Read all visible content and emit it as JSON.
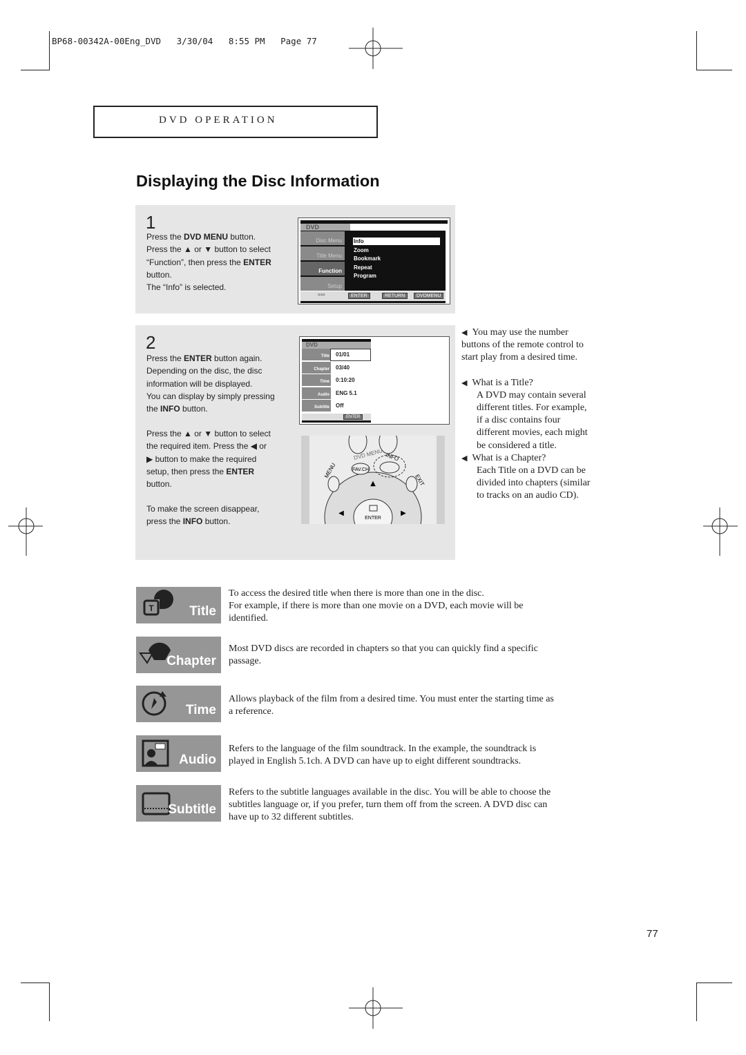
{
  "header": {
    "print_line": "BP68-00342A-00Eng_DVD   3/30/04   8:55 PM   Page 77"
  },
  "section": {
    "title": "DVD OPERATION"
  },
  "page_title": "Displaying the Disc Information",
  "step1": {
    "number": "1",
    "lines": [
      {
        "pre": "Press the ",
        "bold": "DVD MENU",
        "post": " button."
      },
      {
        "pre": "Press the ▲ or ▼ button to select",
        "bold": "",
        "post": ""
      },
      {
        "pre": "“Function”, then press the ",
        "bold": "ENTER",
        "post": ""
      },
      {
        "pre": "button.",
        "bold": "",
        "post": ""
      },
      {
        "pre": "The “Info” is selected.",
        "bold": "",
        "post": ""
      }
    ],
    "screen": {
      "header": "DVD",
      "left_menu": [
        "Disc Menu",
        "Title Menu",
        "Function",
        "Setup"
      ],
      "items": [
        "Info",
        "Zoom",
        "Bookmark",
        "Repeat",
        "Program"
      ],
      "selected": "Info",
      "buttons": [
        "ENTER",
        "RETURN",
        "DVDMENU"
      ]
    }
  },
  "step2": {
    "number": "2",
    "para1": [
      {
        "pre": "Press the ",
        "bold": "ENTER",
        "post": " button again."
      },
      {
        "pre": "Depending on the disc, the disc",
        "bold": "",
        "post": ""
      },
      {
        "pre": "information will be displayed.",
        "bold": "",
        "post": ""
      },
      {
        "pre": "You can display by simply pressing",
        "bold": "",
        "post": ""
      },
      {
        "pre": "the ",
        "bold": "INFO",
        "post": " button."
      }
    ],
    "para2": [
      {
        "pre": "Press the ▲ or ▼ button to select",
        "bold": "",
        "post": ""
      },
      {
        "pre": "the required item. Press the ◀ or",
        "bold": "",
        "post": ""
      },
      {
        "pre": "▶ button to make the required",
        "bold": "",
        "post": ""
      },
      {
        "pre": "setup, then press the ",
        "bold": "ENTER",
        "post": ""
      },
      {
        "pre": "button.",
        "bold": "",
        "post": ""
      }
    ],
    "para3": [
      {
        "pre": "To make the screen disappear,",
        "bold": "",
        "post": ""
      },
      {
        "pre": "press the ",
        "bold": "INFO",
        "post": " button."
      }
    ],
    "screen": {
      "header": "DVD",
      "rows": [
        {
          "label": "Title",
          "value": "01/01"
        },
        {
          "label": "Chapter",
          "value": "03/40"
        },
        {
          "label": "Time",
          "value": "0:10:20"
        },
        {
          "label": "Audio",
          "value": "ENG 5.1"
        },
        {
          "label": "Subtitle",
          "value": "Off"
        }
      ],
      "button": "ENTER"
    },
    "remote": {
      "labels": [
        "DVD MENU",
        "FAV.CH",
        "INFO",
        "MENU",
        "EXIT",
        "ENTER"
      ]
    }
  },
  "notes": [
    {
      "heading": "",
      "lines": [
        "You may use the number",
        "buttons of the remote control to",
        "start play from a desired time."
      ]
    },
    {
      "heading": "What is a Title?",
      "lines": [
        "A DVD may contain several",
        "different titles. For example,",
        "if a disc contains four",
        "different movies, each might",
        "be considered a title."
      ]
    },
    {
      "heading": "What is a Chapter?",
      "lines": [
        "Each Title on a DVD can be",
        "divided into chapters (similar",
        "to tracks on an audio CD)."
      ]
    }
  ],
  "features": [
    {
      "label": "Title",
      "icon": "title-disc-icon",
      "text": [
        "To access the desired title when there is more than one in the disc.",
        "For example, if there is more than one movie on a DVD, each movie will be",
        "identified."
      ]
    },
    {
      "label": "Chapter",
      "icon": "chapter-icon",
      "text": [
        "Most DVD discs are recorded in chapters so that you can quickly find a specific",
        "passage."
      ]
    },
    {
      "label": "Time",
      "icon": "clock-icon",
      "text": [
        "Allows playback of the film from a desired time. You must enter the starting time as",
        "a reference."
      ]
    },
    {
      "label": "Audio",
      "icon": "audio-speaker-icon",
      "text": [
        "Refers to the language of the film soundtrack. In the example, the soundtrack is",
        "played in English 5.1ch. A DVD can have up to eight different soundtracks."
      ]
    },
    {
      "label": "Subtitle",
      "icon": "subtitle-screen-icon",
      "text": [
        "Refers to the subtitle languages available in the disc. You will be able to choose the",
        "subtitles language or, if you prefer, turn them off from the screen. A DVD disc can",
        "have up to 32 different subtitles."
      ]
    }
  ],
  "page_number": "77"
}
